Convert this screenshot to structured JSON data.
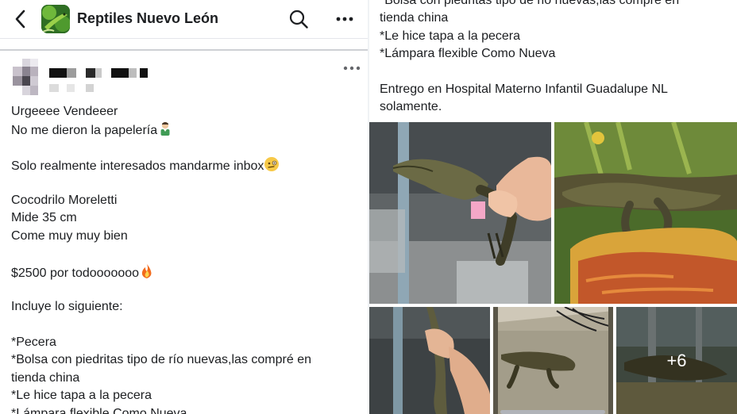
{
  "header": {
    "group_name": "Reptiles Nuevo León"
  },
  "post": {
    "lines_left": [
      "Urgeeee Vendeeer",
      "No me dieron la papelería",
      "",
      "Solo realmente interesados mandarme inbox",
      "",
      "Cocodrilo Moreletti",
      "Mide 35 cm",
      "Come muy muy bien",
      "",
      "$2500 por todooooooo",
      "",
      "Incluye lo siguiente:",
      "",
      "*Pecera",
      "*Bolsa con piedritas tipo de río nuevas,las compré en",
      "tienda china",
      "*Le hice tapa a la pecera",
      "*Lámpara flexible Como Nueva"
    ],
    "lines_right": [
      "*Bolsa con piedritas tipo de rio nuevas,las compre en",
      "tienda china",
      "*Le hice tapa a la pecera",
      "*Lámpara flexible Como Nueva",
      "",
      "Entrego en Hospital Materno Infantil Guadalupe NL",
      "solamente."
    ]
  },
  "photos": {
    "more_count_label": "+6"
  },
  "icons": {
    "back": "back-arrow-icon",
    "search": "search-icon",
    "more": "more-options-icon",
    "emoji_papers": "person-emoji-icon",
    "emoji_inbox": "face-emoji-icon",
    "emoji_fire": "fire-emoji-icon"
  },
  "colors": {
    "text": "#1c1e21",
    "secondary": "#65676b",
    "separator": "#ced0d4"
  }
}
